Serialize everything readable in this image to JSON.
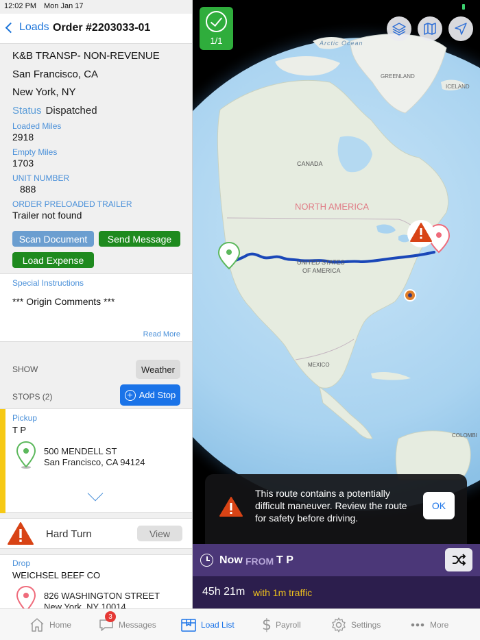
{
  "status_bar": {
    "time": "12:02 PM",
    "date": "Mon Jan 17"
  },
  "header": {
    "back_label": "Loads",
    "title": "Order #2203033-01"
  },
  "order": {
    "company": "K&B TRANSP- NON-REVENUE",
    "origin_city": "San Francisco, CA",
    "destination_city": "New York, NY",
    "status_label": "Status",
    "status_value": "Dispatched",
    "loaded_miles_label": "Loaded Miles",
    "loaded_miles": "2918",
    "empty_miles_label": "Empty Miles",
    "empty_miles": "1703",
    "unit_number_label": "UNIT NUMBER",
    "unit_number": "888",
    "trailer_label": "ORDER PRELOADED TRAILER",
    "trailer_value": "Trailer not found"
  },
  "actions": {
    "scan_document": "Scan Document",
    "send_message": "Send Message",
    "load_expense": "Load Expense"
  },
  "special_instructions": {
    "title": "Special Instructions",
    "content": "*** Origin Comments ***",
    "read_more": "Read More"
  },
  "show": {
    "label": "SHOW",
    "weather_button": "Weather"
  },
  "stops": {
    "label": "STOPS (2)",
    "add_stop_button": "Add Stop",
    "pickup": {
      "type": "Pickup",
      "name": "T P",
      "address_line1": "500 MENDELL ST",
      "address_line2": "San Francisco, CA 94124"
    },
    "hard_turn": {
      "label": "Hard Turn",
      "view_button": "View"
    },
    "drop": {
      "type": "Drop",
      "name": "WEICHSEL BEEF CO",
      "address_line1": "826 WASHINGTON STREET",
      "address_line2": "New York, NY 10014"
    }
  },
  "map": {
    "route_count": "1/1",
    "labels": {
      "arctic_ocean": "Arctic Ocean",
      "greenland": "GREENLAND",
      "iceland": "ICELAND",
      "canada": "CANADA",
      "north_america": "NORTH AMERICA",
      "usa_line1": "UNITED STATES",
      "usa_line2": "OF AMERICA",
      "mexico": "MEXICO",
      "colombia": "COLOMBI"
    },
    "warning_message": "This route contains a potentially difficult maneuver. Review the route for safety before driving.",
    "ok_button": "OK"
  },
  "route_summary": {
    "now": "Now",
    "from": "FROM",
    "origin": "T P",
    "eta": "45h 21m",
    "traffic": "with 1m traffic"
  },
  "tabs": [
    {
      "label": "Home",
      "icon": "home-icon"
    },
    {
      "label": "Messages",
      "icon": "messages-icon",
      "badge": "3"
    },
    {
      "label": "Load List",
      "icon": "load-list-icon"
    },
    {
      "label": "Payroll",
      "icon": "payroll-icon"
    },
    {
      "label": "Settings",
      "icon": "gear-icon"
    },
    {
      "label": "More",
      "icon": "more-icon"
    }
  ],
  "colors": {
    "accent": "#1a73e8",
    "green": "#1e8a1e",
    "pickup_bar": "#f6c915",
    "warning": "#d84315",
    "route": "#1a47b8",
    "purple_dark": "#2c1e4d",
    "purple": "#4b3778"
  }
}
